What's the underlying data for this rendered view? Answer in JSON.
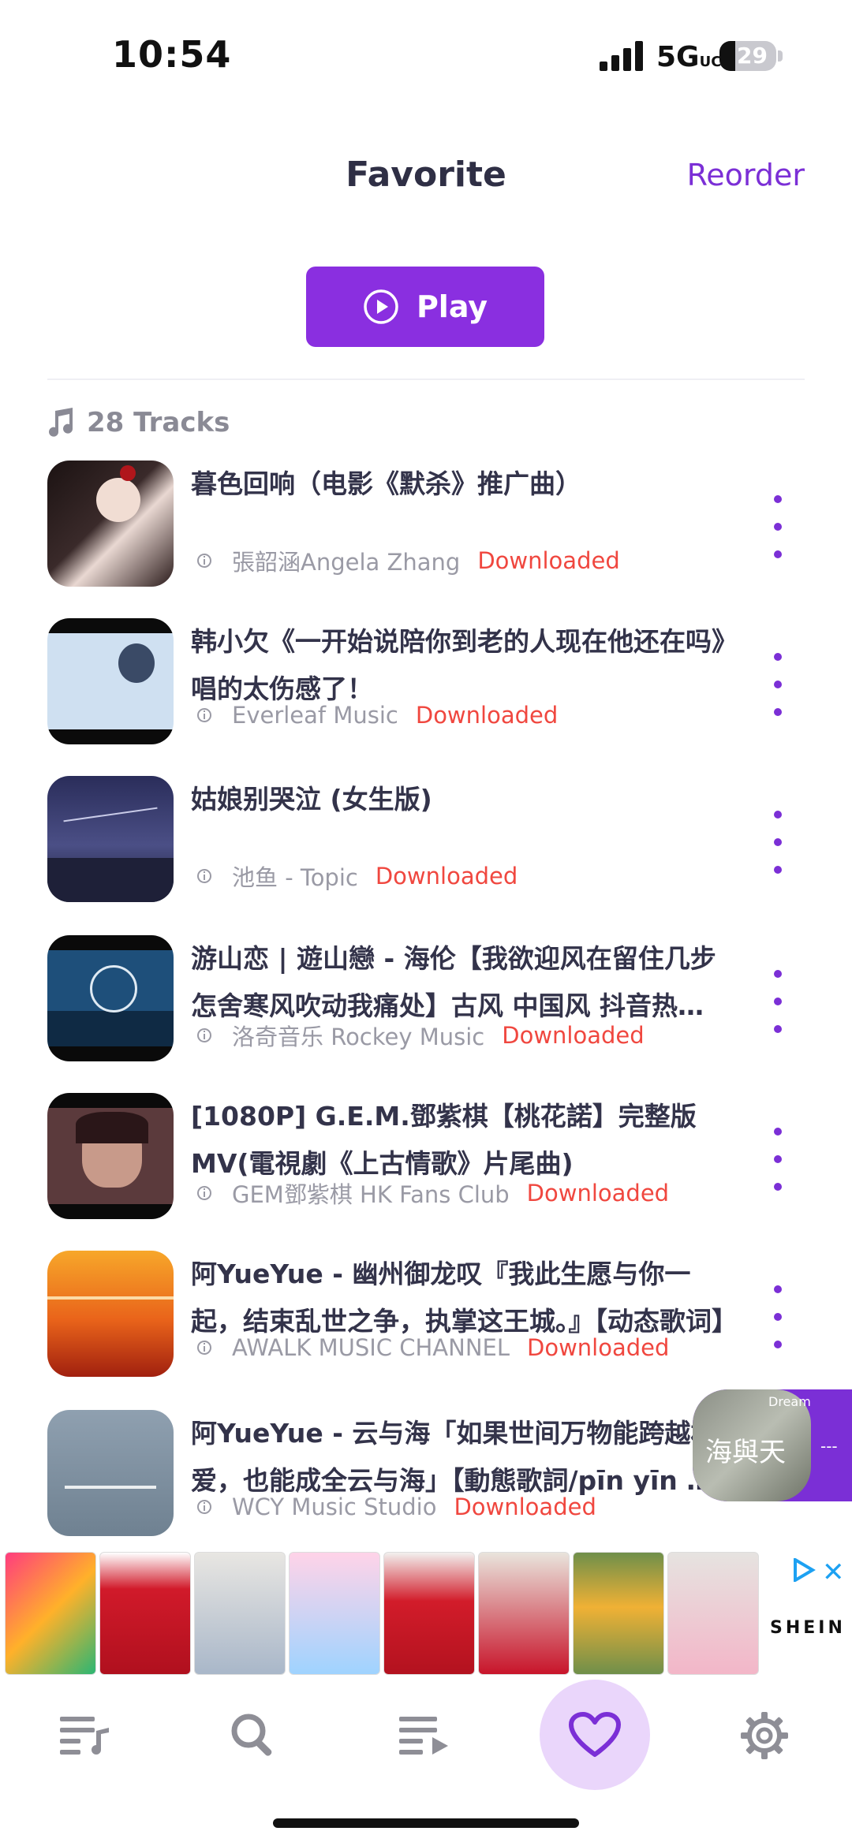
{
  "status_bar": {
    "time": "10:54",
    "network": "5G",
    "network_suffix": "UC",
    "battery": "29"
  },
  "header": {
    "title": "Favorite",
    "reorder_label": "Reorder"
  },
  "play_button": {
    "label": "Play"
  },
  "tracks_header": {
    "count_label": "28 Tracks"
  },
  "tracks": [
    {
      "title": "暮色回响（电影《默杀》推广曲）",
      "artist": "張韶涵Angela Zhang",
      "status": "Downloaded"
    },
    {
      "title": "韩小欠《一开始说陪你到老的人现在他还在吗》唱的太伤感了！",
      "artist": "Everleaf Music",
      "status": "Downloaded"
    },
    {
      "title": "姑娘别哭泣 (女生版)",
      "artist": "池鱼 - Topic",
      "status": "Downloaded"
    },
    {
      "title": "游山恋 | 遊山戀 - 海伦【我欲迎风在留住几步 怎舍寒风吹动我痛处】古风 中国风 抖音热门歌曲",
      "artist": "洛奇音乐 Rockey Music",
      "status": "Downloaded"
    },
    {
      "title": "[1080P] G.E.M.鄧紫棋【桃花諾】完整版MV(電視劇《上古情歌》片尾曲)",
      "artist": "GEM鄧紫棋 HK Fans Club",
      "status": "Downloaded"
    },
    {
      "title": "阿YueYue - 幽州御龙叹『我此生愿与你一起，结束乱世之争，执掌这王城。』【动态歌词】",
      "artist": "AWALK MUSIC CHANNEL",
      "status": "Downloaded"
    },
    {
      "title": "阿YueYue - 云与海「如果世间万物能跨越相爱，也能成全云与海」【動態歌詞/pīn yīn gē cí】",
      "artist": "WCY Music Studio",
      "status": "Downloaded"
    }
  ],
  "mini_player": {
    "art_text": "海與天",
    "art_label": "Dream"
  },
  "ad": {
    "brand": "SHEIN"
  },
  "bottom_nav": [
    {
      "icon": "playlist-icon"
    },
    {
      "icon": "search-icon"
    },
    {
      "icon": "queue-icon"
    },
    {
      "icon": "heart-icon"
    },
    {
      "icon": "gear-icon"
    }
  ],
  "colors": {
    "accent": "#7b2fd6",
    "play_bg": "#8a2fe0",
    "downloaded": "#f0473f",
    "fav_bg": "#ead6fb"
  }
}
